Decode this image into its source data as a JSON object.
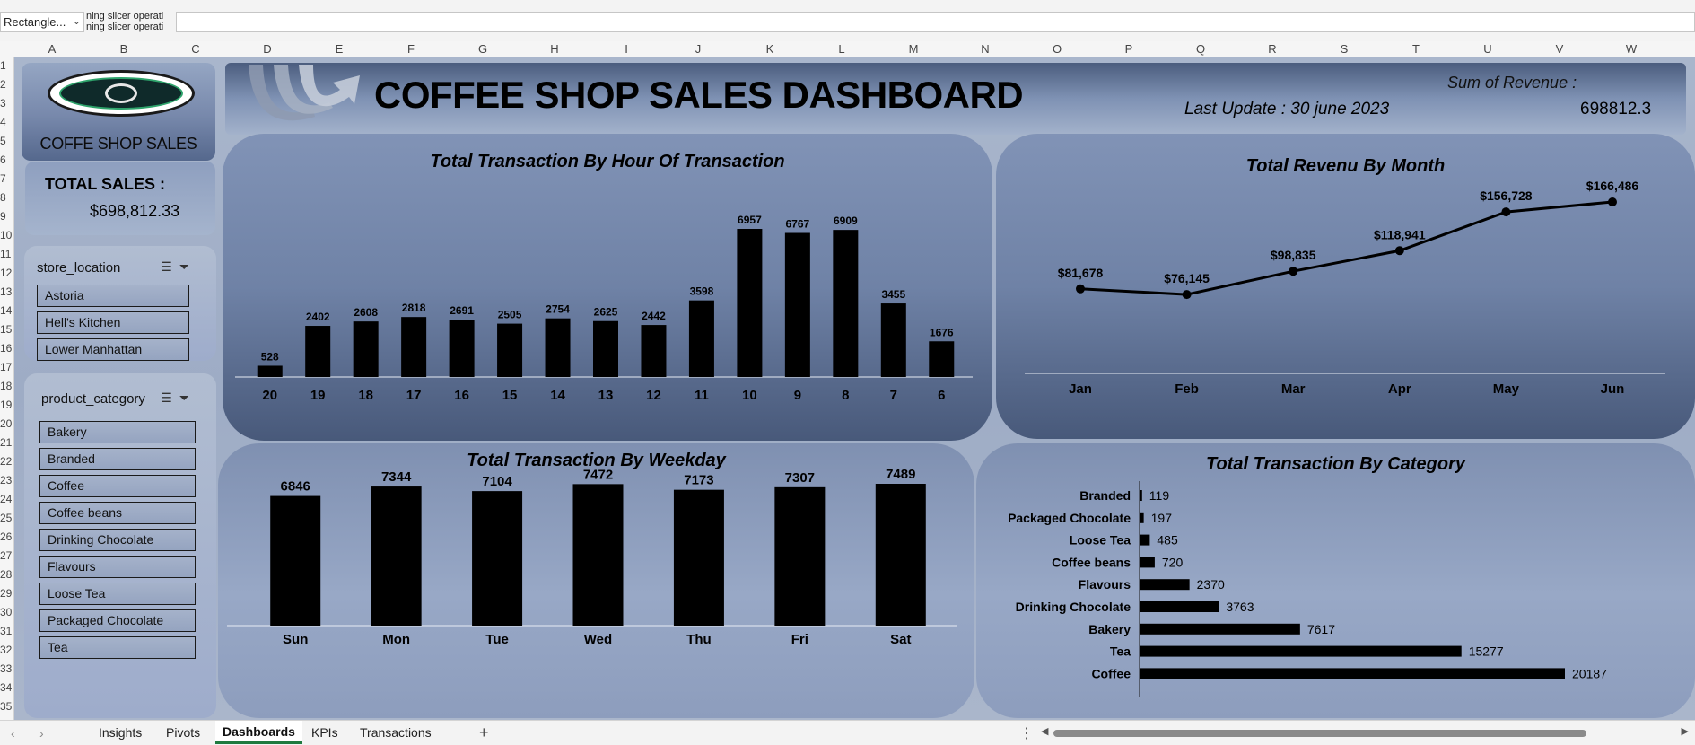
{
  "formula_bar": {
    "name_box": "Rectangle...",
    "preview_lines": [
      "ning slicer operati",
      "ning slicer operati"
    ],
    "formula": ""
  },
  "columns": [
    "A",
    "B",
    "C",
    "D",
    "E",
    "F",
    "G",
    "H",
    "I",
    "J",
    "K",
    "L",
    "M",
    "N",
    "O",
    "P",
    "Q",
    "R",
    "S",
    "T",
    "U",
    "V",
    "W"
  ],
  "rows": [
    "1",
    "2",
    "3",
    "4",
    "5",
    "6",
    "7",
    "8",
    "9",
    "10",
    "11",
    "12",
    "13",
    "14",
    "15",
    "16",
    "17",
    "18",
    "19",
    "20",
    "21",
    "22",
    "23",
    "24",
    "25",
    "26",
    "27",
    "28",
    "29",
    "30",
    "31",
    "32",
    "33",
    "34",
    "35"
  ],
  "logo": {
    "title": "COFFE SHOP SALES"
  },
  "header": {
    "title": "COFFEE SHOP SALES DASHBOARD",
    "last_update": "Last Update : 30 june 2023",
    "revenue_label": "Sum of Revenue :",
    "revenue_value": "698812.3"
  },
  "kpi": {
    "label": "TOTAL SALES :",
    "value": "$698,812.33"
  },
  "slicers": {
    "store": {
      "title": "store_location",
      "items": [
        "Astoria",
        "Hell's Kitchen",
        "Lower Manhattan"
      ]
    },
    "product": {
      "title": "product_category",
      "items": [
        "Bakery",
        "Branded",
        "Coffee",
        "Coffee beans",
        "Drinking Chocolate",
        "Flavours",
        "Loose Tea",
        "Packaged Chocolate",
        "Tea"
      ]
    }
  },
  "chart_data": [
    {
      "type": "bar",
      "title": "Total Transaction By Hour Of Transaction",
      "categories": [
        "20",
        "19",
        "18",
        "17",
        "16",
        "15",
        "14",
        "13",
        "12",
        "11",
        "10",
        "9",
        "8",
        "7",
        "6"
      ],
      "values": [
        528,
        2402,
        2608,
        2818,
        2691,
        2505,
        2754,
        2625,
        2442,
        3598,
        6957,
        6767,
        6909,
        3455,
        1676
      ],
      "data_labels": true,
      "grid": false
    },
    {
      "type": "line",
      "title": "Total Revenu By Month",
      "categories": [
        "Jan",
        "Feb",
        "Mar",
        "Apr",
        "May",
        "Jun"
      ],
      "values": [
        81678,
        76145,
        98835,
        118941,
        156728,
        166486
      ],
      "value_labels": [
        "$81,678",
        "$76,145",
        "$98,835",
        "$118,941",
        "$156,728",
        "$166,486"
      ],
      "grid": false
    },
    {
      "type": "bar",
      "title": "Total Transaction By Weekday",
      "categories": [
        "Sun",
        "Mon",
        "Tue",
        "Wed",
        "Thu",
        "Fri",
        "Sat"
      ],
      "values": [
        6846,
        7344,
        7104,
        7472,
        7173,
        7307,
        7489
      ],
      "data_labels": true,
      "grid": false
    },
    {
      "type": "bar",
      "orientation": "horizontal",
      "title": "Total Transaction By Category",
      "categories": [
        "Branded",
        "Packaged Chocolate",
        "Loose Tea",
        "Coffee beans",
        "Flavours",
        "Drinking Chocolate",
        "Bakery",
        "Tea",
        "Coffee"
      ],
      "values": [
        119,
        197,
        485,
        720,
        2370,
        3763,
        7617,
        15277,
        20187
      ],
      "data_labels": true,
      "grid": false
    }
  ],
  "sheet_tabs": {
    "items": [
      "Insights",
      "Pivots",
      "Dashboards",
      "KPIs",
      "Transactions"
    ],
    "active": "Dashboards"
  },
  "colors": {
    "bar": "#000000",
    "panel_dark": "#3e4f6d",
    "panel_light": "#9aaac6",
    "active_tab": "#1f7a3f"
  }
}
